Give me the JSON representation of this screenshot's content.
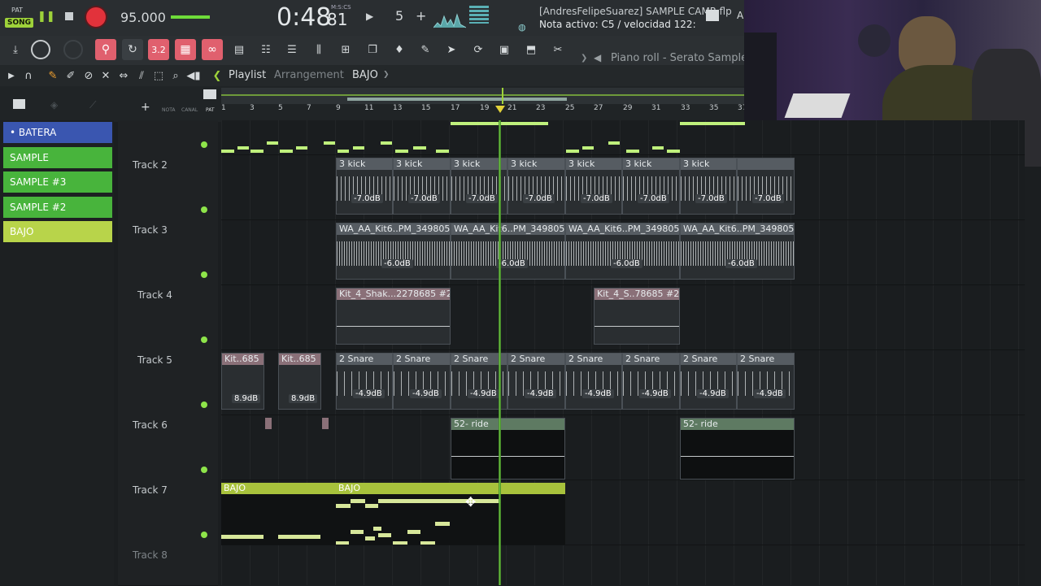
{
  "transport": {
    "pat_label": "PAT",
    "song_label": "SONG",
    "tempo": "95.000",
    "time_main": "0:48",
    "time_frac": "81",
    "time_unit": "M:S:CS",
    "pattern_number": "5",
    "plus": "+",
    "project_title": "[AndresFelipeSuarez] SAMPLE CAMR.flp",
    "hint_text": "Nota activo: C5 / velocidad 122:",
    "piano_roll_label": "Piano roll - Serato Sample"
  },
  "playlist": {
    "title": "Playlist",
    "subtitle": "Arrangement",
    "current_pattern": "BAJO",
    "ruler_labels": [
      "NOTA",
      "CANAL",
      "PAT"
    ],
    "bars": [
      "1",
      "3",
      "5",
      "7",
      "9",
      "11",
      "13",
      "15",
      "17",
      "19",
      "21",
      "23",
      "25",
      "27",
      "29",
      "31",
      "33",
      "35",
      "37"
    ]
  },
  "patterns": [
    {
      "label": "• BATERA",
      "color": "#3a56b0"
    },
    {
      "label": "SAMPLE",
      "color": "#48b43c"
    },
    {
      "label": "SAMPLE #3",
      "color": "#48b43c"
    },
    {
      "label": "SAMPLE #2",
      "color": "#48b43c"
    },
    {
      "label": "BAJO",
      "color": "#b8d44a"
    }
  ],
  "tracks": [
    {
      "name": "Track 2"
    },
    {
      "name": "Track 3"
    },
    {
      "name": "Track 4"
    },
    {
      "name": "Track 5"
    },
    {
      "name": "Track 6"
    },
    {
      "name": "Track 7"
    },
    {
      "name": "Track 8"
    }
  ],
  "clips": {
    "kick": "3 kick",
    "kick_db": "-7.0dB",
    "kit6": "WA_AA_Kit6..PM_3498054",
    "kit6_db": "-6.0dB",
    "shaker": "Kit_4_Shak...2278685 #2",
    "shaker2": "Kit_4_S..78685 #2",
    "kit_short": "Kit..685",
    "kit_short_db": "8.9dB",
    "snare": "2 Snare",
    "snare_db": "-4.9dB",
    "ride": "52-  ride",
    "bajo": "BAJO"
  }
}
